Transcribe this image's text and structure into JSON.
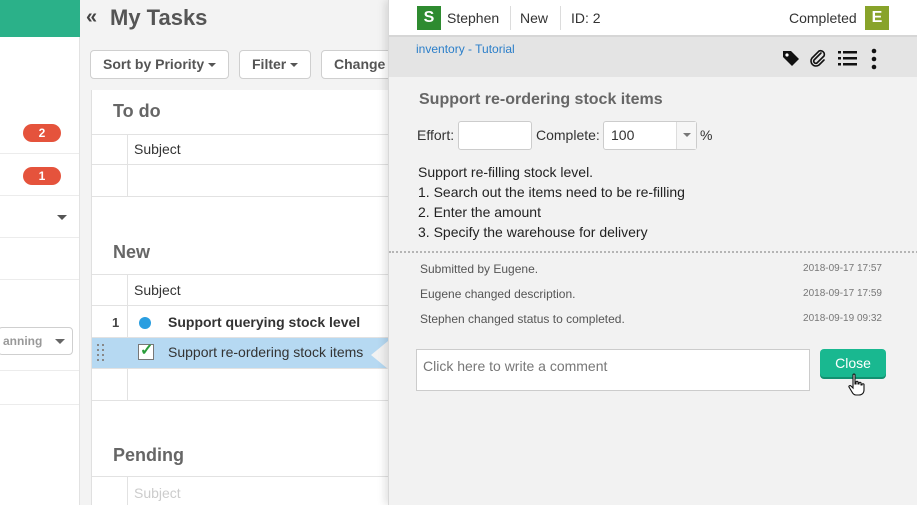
{
  "main": {
    "title": "My Tasks",
    "toolbar": {
      "sort_label": "Sort by Priority",
      "filter_label": "Filter",
      "change_label": "Change"
    },
    "sections": [
      {
        "title": "To do",
        "subject_header": "Subject"
      },
      {
        "title": "New",
        "subject_header": "Subject",
        "rows": [
          {
            "number": "1",
            "subject": "Support querying stock level",
            "status": "blue-dot-icon"
          },
          {
            "number": "",
            "subject": "Support re-ordering stock items",
            "status": "checkbox-checked-icon",
            "selected": true
          }
        ]
      },
      {
        "title": "Pending",
        "subject_header": "Subject"
      }
    ]
  },
  "sidebar": {
    "badges": [
      "2",
      "1"
    ],
    "planning_label": "anning"
  },
  "panel": {
    "header": {
      "assignee_initial": "S",
      "assignee_name": "Stephen",
      "state": "New",
      "id_label": "ID: 2",
      "status": "Completed",
      "status_initial": "E"
    },
    "project_link": "inventory - Tutorial",
    "task_title": "Support re-ordering stock items",
    "effort_label": "Effort:",
    "effort_value": "",
    "complete_label": "Complete:",
    "complete_value": "100",
    "percent_sign": "%",
    "description": [
      "Support re-filling stock level.",
      "1. Search out the items need to be re-filling",
      "2. Enter the amount",
      "3. Specify the warehouse for delivery"
    ],
    "history": [
      {
        "text": "Submitted by Eugene.",
        "time": "2018-09-17 17:57"
      },
      {
        "text": "Eugene changed description.",
        "time": "2018-09-17 17:59"
      },
      {
        "text": "Stephen changed status to completed.",
        "time": "2018-09-19 09:32"
      }
    ],
    "comment_placeholder": "Click here to write a comment",
    "close_label": "Close"
  },
  "colors": {
    "accent": "#2bb189",
    "badge": "#e5533c",
    "close_button": "#19b890",
    "selected_row": "#b6d9f2",
    "link": "#2a7ec9"
  }
}
